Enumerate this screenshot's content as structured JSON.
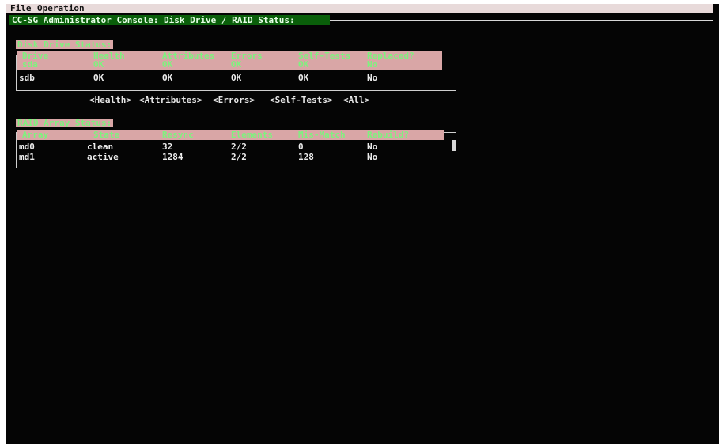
{
  "menu": {
    "file": "File",
    "operation": "Operation"
  },
  "title": "CC-SG Administrator Console: Disk Drive / RAID Status:",
  "disk": {
    "caption": "Disk Drive Status:",
    "headers": [
      "Drive",
      "Health",
      "Attributes",
      "Errors",
      "Self-Tests",
      "Replaced?"
    ],
    "header_values": [
      "sda",
      "OK",
      "OK",
      "OK",
      "OK",
      "No"
    ],
    "rows": [
      [
        "sdb",
        "OK",
        "OK",
        "OK",
        "OK",
        "No"
      ]
    ]
  },
  "buttons": {
    "health": "<Health>",
    "attributes": "<Attributes>",
    "errors": "<Errors>",
    "self_tests": "<Self-Tests>",
    "all": "<All>"
  },
  "raid": {
    "caption": "RAID Array Status:",
    "headers": [
      "Array",
      "State",
      "Resync",
      "Elements",
      "Mis-Match",
      "Rebuild?"
    ],
    "rows": [
      [
        "md0",
        "clean",
        "32",
        "2/2",
        "0",
        "No"
      ],
      [
        "md1",
        "active",
        "1284",
        "2/2",
        "128",
        "No"
      ]
    ]
  }
}
